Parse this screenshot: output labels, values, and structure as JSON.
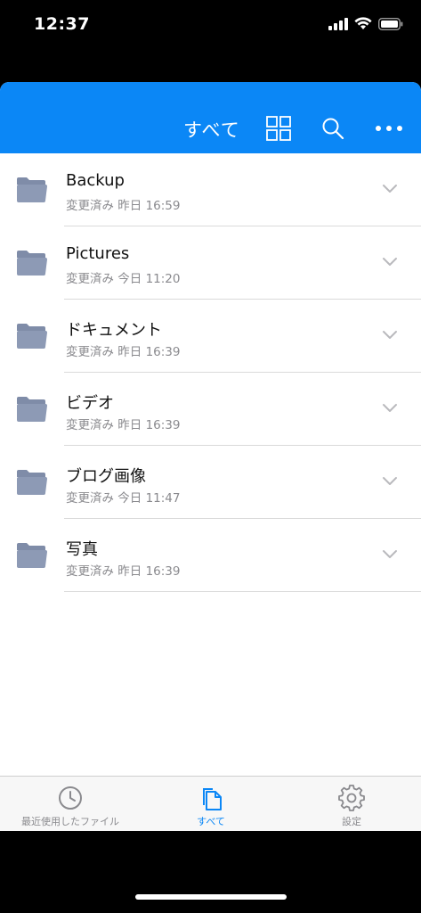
{
  "status_bar": {
    "time": "12:37",
    "icons": [
      "cellular-signal-icon",
      "wifi-icon",
      "battery-icon"
    ]
  },
  "navbar": {
    "title": "すべて",
    "actions": [
      "grid-view-icon",
      "search-icon",
      "more-icon"
    ]
  },
  "files": [
    {
      "name": "Backup",
      "meta": "変更済み 昨日 16:59",
      "icon": "folder-icon"
    },
    {
      "name": "Pictures",
      "meta": "変更済み 今日 11:20",
      "icon": "folder-icon"
    },
    {
      "name": "ドキュメント",
      "meta": "変更済み 昨日 16:39",
      "icon": "folder-icon"
    },
    {
      "name": "ビデオ",
      "meta": "変更済み 昨日 16:39",
      "icon": "folder-icon"
    },
    {
      "name": "ブログ画像",
      "meta": "変更済み 今日 11:47",
      "icon": "folder-icon"
    },
    {
      "name": "写真",
      "meta": "変更済み 昨日 16:39",
      "icon": "folder-icon"
    }
  ],
  "tabbar": {
    "tabs": [
      {
        "label": "最近使用したファイル",
        "icon": "clock-icon",
        "active": false
      },
      {
        "label": "すべて",
        "icon": "files-icon",
        "active": true
      },
      {
        "label": "設定",
        "icon": "gear-icon",
        "active": false
      }
    ]
  },
  "colors": {
    "accent": "#0b87f6",
    "folder": "#8d9ab5",
    "meta_text": "#8a8a8e",
    "divider": "#dadada"
  }
}
